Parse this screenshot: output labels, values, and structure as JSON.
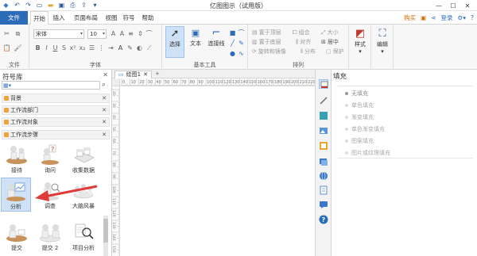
{
  "app": {
    "title": "亿图图示（试用版）",
    "menu": [
      "文件",
      "开始",
      "插入",
      "页面布局",
      "视图",
      "符号",
      "帮助"
    ],
    "buy": "购买",
    "login": "登录"
  },
  "ribbon": {
    "groups": [
      "文件",
      "字体",
      "基本工具",
      "排列"
    ],
    "font_name": "宋体",
    "font_size": "10",
    "tools": [
      "选择",
      "文本",
      "连接线"
    ],
    "arrange_items": [
      "置于顶层",
      "组合",
      "大小",
      "置于底层",
      "对齐",
      "居中",
      "旋转和镜像",
      "分布",
      "保护"
    ],
    "style_label": "样式",
    "edit_label": "编辑"
  },
  "left_panel": {
    "title": "符号库",
    "categories": [
      "背景",
      "工作流部门",
      "工作流对象",
      "工作流步骤"
    ],
    "shapes": [
      [
        "接待",
        "询问",
        "收集数据"
      ],
      [
        "分析",
        "调查",
        "大脑风暴"
      ],
      [
        "提交",
        "提交 2",
        "项目分析"
      ]
    ]
  },
  "canvas": {
    "tab": "绘图1",
    "h_ruler": [
      "0",
      "10",
      "20",
      "30",
      "40",
      "50",
      "60",
      "70",
      "80",
      "90",
      "100",
      "110",
      "120",
      "130",
      "140",
      "150",
      "160",
      "170",
      "180",
      "190",
      "200",
      "210",
      "220"
    ],
    "v_ruler": [
      "20",
      "30",
      "40",
      "50",
      "60",
      "70",
      "80",
      "90",
      "100",
      "110",
      "120",
      "130",
      "140",
      "150"
    ]
  },
  "fill_panel": {
    "title": "填充",
    "options": [
      "无填充",
      "单色填充",
      "渐变填充",
      "单色渐变填充",
      "图案填充",
      "图片或纹理填充"
    ]
  },
  "colors": {
    "file_tab": "#2b6cb8",
    "accent": "#2b6cb8",
    "buy": "#d06b00",
    "arrow": "#e03a3a",
    "selected_shape": "#cfe1f6"
  }
}
